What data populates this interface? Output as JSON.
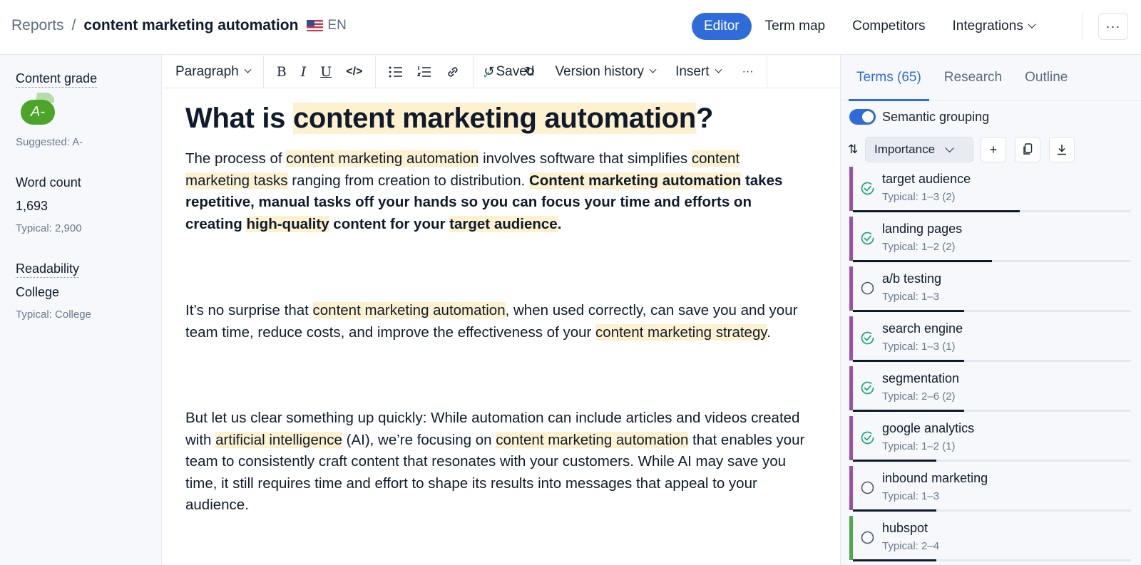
{
  "header": {
    "breadcrumb_parent": "Reports",
    "breadcrumb_sep": "/",
    "title": "content marketing automation",
    "language": "EN",
    "nav": [
      {
        "label": "Editor",
        "active": true
      },
      {
        "label": "Term map"
      },
      {
        "label": "Competitors"
      },
      {
        "label": "Integrations",
        "dropdown": true
      }
    ],
    "more_label": "···"
  },
  "left": {
    "grade_label": "Content grade",
    "grade_value": "A-",
    "grade_suggested": "Suggested: A-",
    "word_count_label": "Word count",
    "word_count_value": "1,693",
    "word_count_typical": "Typical: 2,900",
    "readability_label": "Readability",
    "readability_value": "College",
    "readability_typical": "Typical: College"
  },
  "toolbar": {
    "paragraph": "Paragraph",
    "bold": "B",
    "italic": "I",
    "underline": "U",
    "code": "</>",
    "saved": "Saved",
    "version_history": "Version history",
    "insert": "Insert",
    "more": "···"
  },
  "document": {
    "heading_pre": "What is ",
    "heading_hl": "content marketing automation",
    "heading_post": "?",
    "p1": {
      "t1": "The process of ",
      "h1": "content marketing automation",
      "t2": " involves software that simplifies ",
      "h2": "content marketing tasks",
      "t3": " ranging from creation to distribution. ",
      "b_h1": "Content marketing automation",
      "b_t1": " takes repetitive, manual tasks off your hands so you can focus your time and efforts on creating ",
      "b_h2": "high-quality",
      "b_t2": " content for your ",
      "b_h3": "target audience",
      "b_t3": "."
    },
    "p2": {
      "t1": "It’s no surprise that ",
      "h1": "content marketing automation",
      "t2": ", when used correctly, can save you and your team time, reduce costs, and improve the effectiveness of your ",
      "h2": "content marketing strategy",
      "t3": "."
    },
    "p3": {
      "t1": "But let us clear something up quickly: While automation can include articles and videos created with ",
      "h1": "artificial intelligence",
      "t2": " (AI), we’re focusing on ",
      "h2": "content marketing automation",
      "t3": " that enables your team to consistently craft content that resonates with your customers. While AI may save you time, it still requires time and effort to shape its results into messages that appeal to your audience."
    }
  },
  "right": {
    "tabs": [
      {
        "label": "Terms (65)",
        "active": true
      },
      {
        "label": "Research"
      },
      {
        "label": "Outline"
      }
    ],
    "semantic_grouping_label": "Semantic grouping",
    "semantic_grouping_on": true,
    "sort_select": "Importance",
    "terms": [
      {
        "name": "target audience",
        "typical": "Typical: 1–3 (2)",
        "done": true,
        "group_color": "#9b4fa8",
        "progress": 0.6
      },
      {
        "name": "landing pages",
        "typical": "Typical: 1–2 (2)",
        "done": true,
        "group_color": "#9b4fa8",
        "progress": 0.5
      },
      {
        "name": "a/b testing",
        "typical": "Typical: 1–3",
        "done": false,
        "group_color": "#9b4fa8",
        "progress": 0.4
      },
      {
        "name": "search engine",
        "typical": "Typical: 1–3 (1)",
        "done": true,
        "group_color": "#9b4fa8",
        "progress": 0.4
      },
      {
        "name": "segmentation",
        "typical": "Typical: 2–6 (2)",
        "done": true,
        "group_color": "#9b4fa8",
        "progress": 0.4
      },
      {
        "name": "google analytics",
        "typical": "Typical: 1–2 (1)",
        "done": true,
        "group_color": "#9b4fa8",
        "progress": 0.3
      },
      {
        "name": "inbound marketing",
        "typical": "Typical: 1–3",
        "done": false,
        "group_color": "#9b4fa8",
        "progress": 0.3
      },
      {
        "name": "hubspot",
        "typical": "Typical: 2–4",
        "done": false,
        "group_color": "#4ca84a",
        "progress": 0.3
      }
    ]
  },
  "colors": {
    "accent": "#2f6bd9",
    "highlight": "#fdf1cf",
    "grade": "#4ca528",
    "check": "#1fa776"
  }
}
